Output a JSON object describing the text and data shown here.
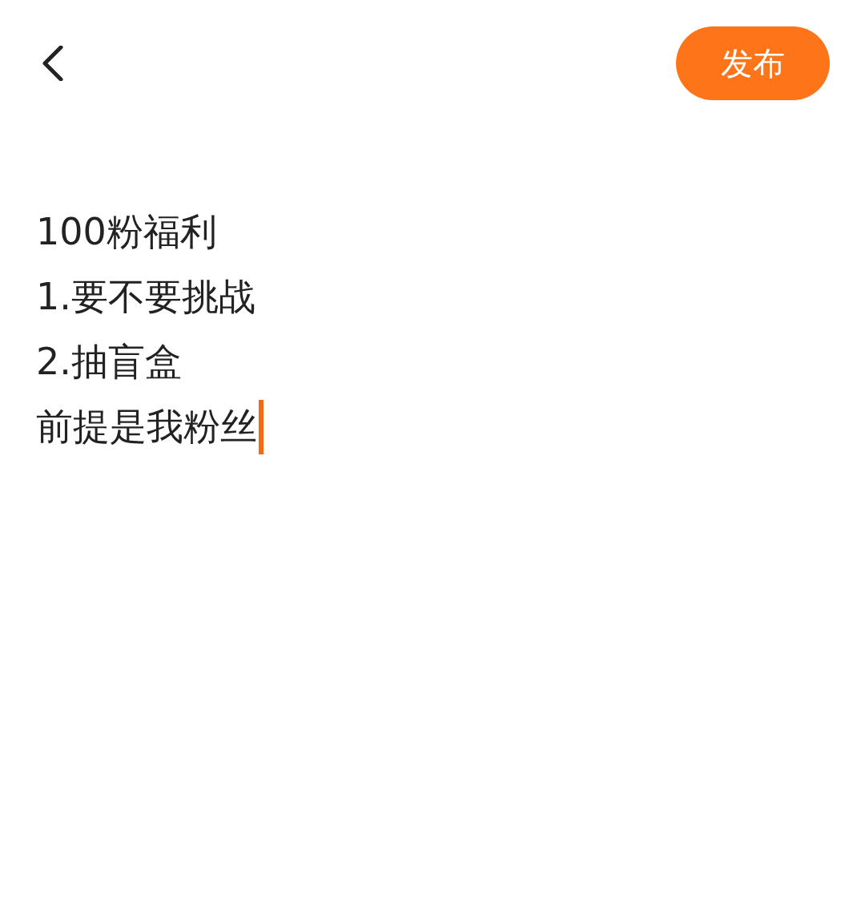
{
  "header": {
    "publish_button": "发布"
  },
  "editor": {
    "focused": true,
    "lines": [
      "100粉福利",
      "1.要不要挑战",
      "2.抽盲盒",
      "前提是我粉丝"
    ]
  }
}
